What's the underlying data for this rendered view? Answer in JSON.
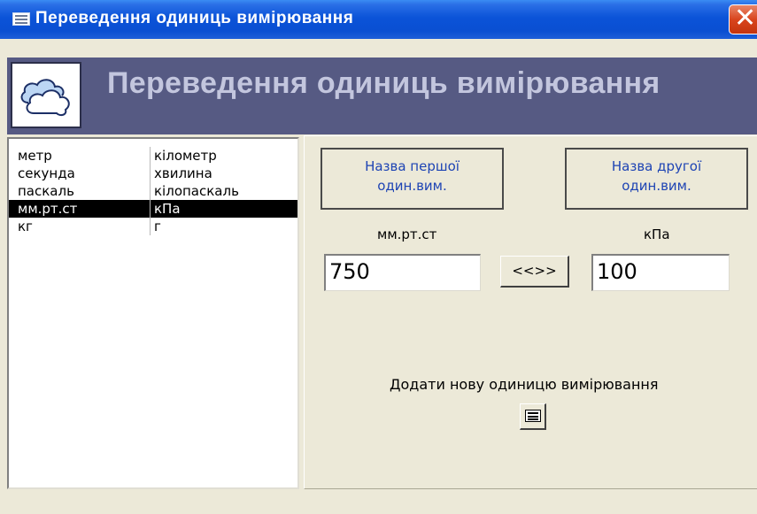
{
  "window": {
    "title": "Переведення одиниць вимірювання",
    "close_glyph": "✕"
  },
  "header": {
    "title": "Переведення одиниць вимірювання",
    "logo_icon": "cloud-icon"
  },
  "units_list": {
    "rows": [
      {
        "first": "метр",
        "second": "кілометр",
        "selected": false
      },
      {
        "first": "секунда",
        "second": "хвилина",
        "selected": false
      },
      {
        "first": "паскаль",
        "second": "кілопаскаль",
        "selected": false
      },
      {
        "first": "мм.рт.ст",
        "second": "кПа",
        "selected": true
      },
      {
        "first": "кг",
        "second": "г",
        "selected": false
      }
    ]
  },
  "converter": {
    "first_name_label": "Назва першої\nодин.вим.",
    "second_name_label": "Назва другої\nодин.вим.",
    "first_unit": "мм.рт.ст",
    "second_unit": "кПа",
    "first_value": "750",
    "second_value": "100",
    "swap_label": "<<>>"
  },
  "add_unit": {
    "label": "Додати нову одиницю вимірювання",
    "button_icon": "form-icon"
  }
}
